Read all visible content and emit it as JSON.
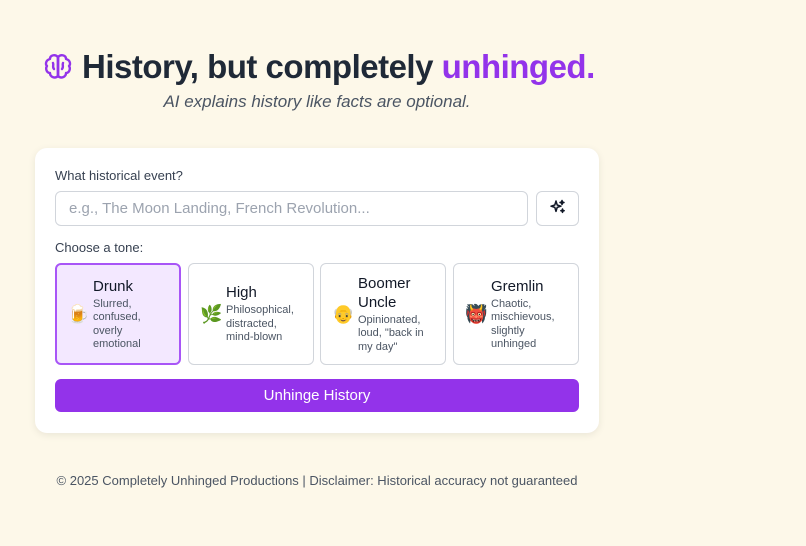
{
  "header": {
    "title_main": "History, but completely ",
    "title_accent": "unhinged.",
    "subtitle": "AI explains history like facts are optional.",
    "icon": "brain-icon"
  },
  "form": {
    "event_label": "What historical event?",
    "event_placeholder": "e.g., The Moon Landing, French Revolution...",
    "event_value": "",
    "random_button_icon": "sparkles-icon",
    "tone_label": "Choose a tone:",
    "tones": [
      {
        "name": "Drunk",
        "emoji": "🍺",
        "description": "Slurred, confused, overly emotional",
        "selected": true
      },
      {
        "name": "High",
        "emoji": "🌿",
        "description": "Philosophical, distracted, mind-blown",
        "selected": false
      },
      {
        "name": "Boomer Uncle",
        "emoji": "👴",
        "description": "Opinionated, loud, \"back in my day\"",
        "selected": false
      },
      {
        "name": "Gremlin",
        "emoji": "👹",
        "description": "Chaotic, mischievous, slightly unhinged",
        "selected": false
      }
    ],
    "submit_label": "Unhinge History"
  },
  "footer": {
    "text": "© 2025 Completely Unhinged Productions | Disclaimer: Historical accuracy not guaranteed"
  },
  "colors": {
    "accent": "#9333ea",
    "background": "#fdf8e9",
    "selected_bg": "#f3e8ff"
  }
}
